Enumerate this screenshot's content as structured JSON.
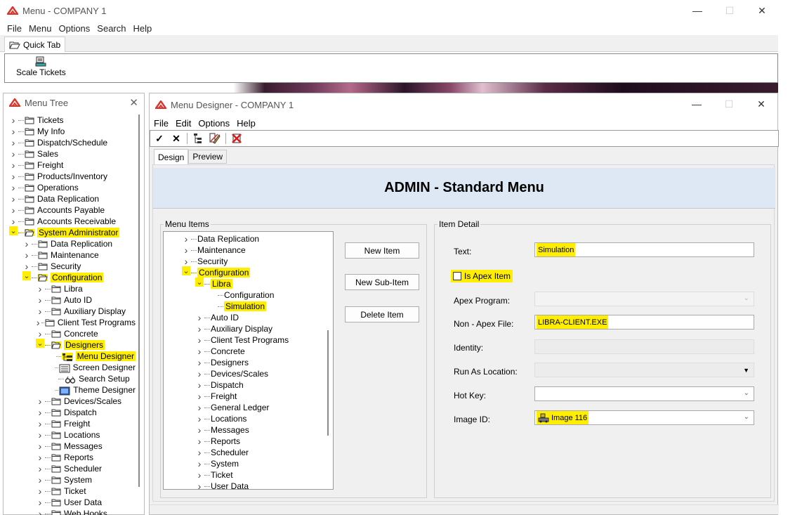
{
  "main": {
    "title": "Menu - COMPANY 1",
    "menu": [
      "File",
      "Menu",
      "Options",
      "Search",
      "Help"
    ],
    "quick_tab_label": "Quick Tab",
    "scale_tickets_label": "Scale Tickets"
  },
  "menu_tree": {
    "title": "Menu Tree",
    "items": [
      {
        "label": "Tickets",
        "level": 0,
        "chev": ">",
        "hl": false
      },
      {
        "label": "My Info",
        "level": 0,
        "chev": ">",
        "hl": false
      },
      {
        "label": "Dispatch/Schedule",
        "level": 0,
        "chev": ">",
        "hl": false
      },
      {
        "label": "Sales",
        "level": 0,
        "chev": ">",
        "hl": false
      },
      {
        "label": "Freight",
        "level": 0,
        "chev": ">",
        "hl": false
      },
      {
        "label": "Products/Inventory",
        "level": 0,
        "chev": ">",
        "hl": false
      },
      {
        "label": "Operations",
        "level": 0,
        "chev": ">",
        "hl": false
      },
      {
        "label": "Data Replication",
        "level": 0,
        "chev": ">",
        "hl": false
      },
      {
        "label": "Accounts Payable",
        "level": 0,
        "chev": ">",
        "hl": false
      },
      {
        "label": "Accounts Receivable",
        "level": 0,
        "chev": ">",
        "hl": false
      },
      {
        "label": "System Administrator",
        "level": 0,
        "chev": "v",
        "hl": true,
        "open": true
      },
      {
        "label": "Data Replication",
        "level": 1,
        "chev": ">",
        "hl": false
      },
      {
        "label": "Maintenance",
        "level": 1,
        "chev": ">",
        "hl": false
      },
      {
        "label": "Security",
        "level": 1,
        "chev": ">",
        "hl": false
      },
      {
        "label": "Configuration",
        "level": 1,
        "chev": "v",
        "hl": true,
        "open": true
      },
      {
        "label": "Libra",
        "level": 2,
        "chev": ">",
        "hl": false
      },
      {
        "label": "Auto ID",
        "level": 2,
        "chev": ">",
        "hl": false
      },
      {
        "label": "Auxiliary Display",
        "level": 2,
        "chev": ">",
        "hl": false
      },
      {
        "label": "Client Test Programs",
        "level": 2,
        "chev": ">",
        "hl": false
      },
      {
        "label": "Concrete",
        "level": 2,
        "chev": ">",
        "hl": false
      },
      {
        "label": "Designers",
        "level": 2,
        "chev": "v",
        "hl": true,
        "open": true
      },
      {
        "label": "Menu Designer",
        "level": 3,
        "chev": "",
        "hl": true,
        "icon": "menu-designer-icon"
      },
      {
        "label": "Screen Designer",
        "level": 3,
        "chev": "",
        "hl": false,
        "icon": "screen-designer-icon"
      },
      {
        "label": "Search Setup",
        "level": 3,
        "chev": "",
        "hl": false,
        "icon": "search-setup-icon"
      },
      {
        "label": "Theme Designer",
        "level": 3,
        "chev": "",
        "hl": false,
        "icon": "theme-designer-icon"
      },
      {
        "label": "Devices/Scales",
        "level": 2,
        "chev": ">",
        "hl": false
      },
      {
        "label": "Dispatch",
        "level": 2,
        "chev": ">",
        "hl": false
      },
      {
        "label": "Freight",
        "level": 2,
        "chev": ">",
        "hl": false
      },
      {
        "label": "Locations",
        "level": 2,
        "chev": ">",
        "hl": false
      },
      {
        "label": "Messages",
        "level": 2,
        "chev": ">",
        "hl": false
      },
      {
        "label": "Reports",
        "level": 2,
        "chev": ">",
        "hl": false
      },
      {
        "label": "Scheduler",
        "level": 2,
        "chev": ">",
        "hl": false
      },
      {
        "label": "System",
        "level": 2,
        "chev": ">",
        "hl": false
      },
      {
        "label": "Ticket",
        "level": 2,
        "chev": ">",
        "hl": false
      },
      {
        "label": "User Data",
        "level": 2,
        "chev": ">",
        "hl": false
      },
      {
        "label": "Web Hooks",
        "level": 2,
        "chev": ">",
        "hl": false
      }
    ]
  },
  "designer": {
    "title": "Menu Designer - COMPANY 1",
    "menu": [
      "File",
      "Edit",
      "Options",
      "Help"
    ],
    "tabs": [
      "Design",
      "Preview"
    ],
    "header": "ADMIN - Standard Menu",
    "menu_items_label": "Menu Items",
    "item_detail_label": "Item Detail",
    "buttons": {
      "new_item": "New Item",
      "new_sub_item": "New Sub-Item",
      "delete_item": "Delete Item"
    },
    "menu_items": [
      {
        "label": "Data Replication",
        "level": 0,
        "chev": ">",
        "hl": false
      },
      {
        "label": "Maintenance",
        "level": 0,
        "chev": ">",
        "hl": false
      },
      {
        "label": "Security",
        "level": 0,
        "chev": ">",
        "hl": false
      },
      {
        "label": "Configuration",
        "level": 0,
        "chev": "v",
        "hl": true
      },
      {
        "label": "Libra",
        "level": 1,
        "chev": "v",
        "hl": true
      },
      {
        "label": "Configuration",
        "level": 2,
        "chev": "",
        "hl": false
      },
      {
        "label": "Simulation",
        "level": 2,
        "chev": "",
        "hl": true
      },
      {
        "label": "Auto ID",
        "level": 1,
        "chev": ">",
        "hl": false
      },
      {
        "label": "Auxiliary Display",
        "level": 1,
        "chev": ">",
        "hl": false
      },
      {
        "label": "Client Test Programs",
        "level": 1,
        "chev": ">",
        "hl": false
      },
      {
        "label": "Concrete",
        "level": 1,
        "chev": ">",
        "hl": false
      },
      {
        "label": "Designers",
        "level": 1,
        "chev": ">",
        "hl": false
      },
      {
        "label": "Devices/Scales",
        "level": 1,
        "chev": ">",
        "hl": false
      },
      {
        "label": "Dispatch",
        "level": 1,
        "chev": ">",
        "hl": false
      },
      {
        "label": "Freight",
        "level": 1,
        "chev": ">",
        "hl": false
      },
      {
        "label": "General Ledger",
        "level": 1,
        "chev": ">",
        "hl": false
      },
      {
        "label": "Locations",
        "level": 1,
        "chev": ">",
        "hl": false
      },
      {
        "label": "Messages",
        "level": 1,
        "chev": ">",
        "hl": false
      },
      {
        "label": "Reports",
        "level": 1,
        "chev": ">",
        "hl": false
      },
      {
        "label": "Scheduler",
        "level": 1,
        "chev": ">",
        "hl": false
      },
      {
        "label": "System",
        "level": 1,
        "chev": ">",
        "hl": false
      },
      {
        "label": "Ticket",
        "level": 1,
        "chev": ">",
        "hl": false
      },
      {
        "label": "User Data",
        "level": 1,
        "chev": ">",
        "hl": false
      }
    ],
    "detail": {
      "text_label": "Text:",
      "text_value": "Simulation",
      "is_apex_label": "Is Apex Item",
      "apex_program_label": "Apex Program:",
      "non_apex_label": "Non - Apex File:",
      "non_apex_value": "LIBRA-CLIENT.EXE",
      "identity_label": "Identity:",
      "run_as_label": "Run As Location:",
      "hot_key_label": "Hot Key:",
      "image_id_label": "Image ID:",
      "image_id_value": "Image 116"
    }
  }
}
